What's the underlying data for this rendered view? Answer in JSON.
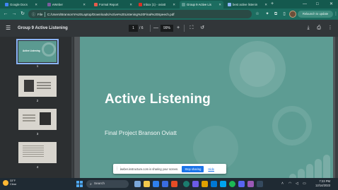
{
  "browser": {
    "tabs": [
      {
        "label": "Google Docs",
        "color": "#4285f4",
        "active": false
      },
      {
        "label": "eWeber",
        "color": "#7a5c9e",
        "active": false
      },
      {
        "label": "Formal Report",
        "color": "#e65b4a",
        "active": false
      },
      {
        "label": "Inbox (1) - oviatt",
        "color": "#d93025",
        "active": false
      },
      {
        "label": "Group 9 Active Lis",
        "color": "#5b9a91",
        "active": true
      },
      {
        "label": "best active listenin",
        "color": "#8ab4f8",
        "active": false
      }
    ],
    "new_tab": "+",
    "window_controls": {
      "minimize": "—",
      "maximize": "□",
      "close": "✕"
    }
  },
  "addressbar": {
    "scheme": "File",
    "url": "C:/Users/Branson's%20Laptop/Downloads/Active%20Listening%20Final%20Speech.pdf",
    "relaunch_label": "Relaunch to update"
  },
  "pdf": {
    "title": "Group 9 Active Listening",
    "page_current": "1",
    "page_total": "/ 6",
    "zoom": "99%",
    "zoom_out": "—",
    "zoom_in": "+"
  },
  "thumbnails": [
    {
      "num": "1",
      "title": "Active Listening"
    },
    {
      "num": "2"
    },
    {
      "num": "3"
    },
    {
      "num": "4"
    }
  ],
  "slide": {
    "title": "Active Listening",
    "subtitle": "Final Project Branson Oviatt",
    "background": "#5d9c93",
    "decorative_bar_levels": [
      0.3,
      0.45,
      0.6,
      0.75,
      0.9
    ]
  },
  "share_notice": {
    "message": "weber.instructure.com is sharing your screen.",
    "stop_label": "Stop sharing",
    "hide_label": "Hide"
  },
  "taskbar": {
    "weather_temp": "33°F",
    "weather_desc": "Clear",
    "search_label": "Search",
    "time": "7:23 PM",
    "date": "12/14/2023"
  }
}
